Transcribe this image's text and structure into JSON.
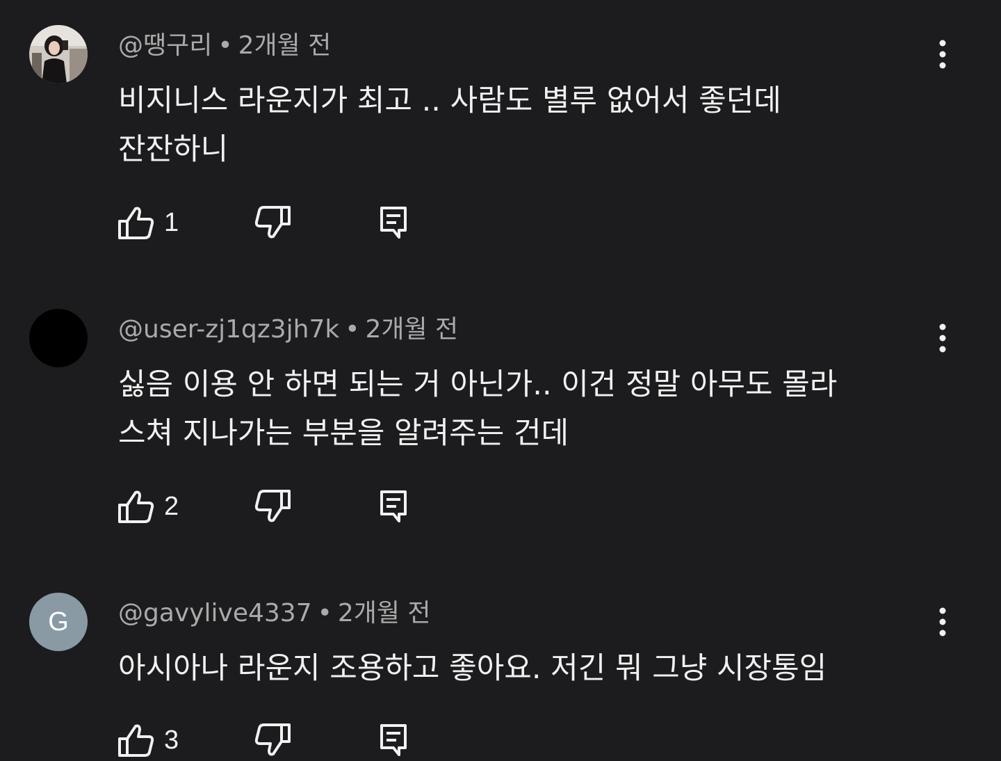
{
  "comments": [
    {
      "handle": "@땡구리",
      "separator": "•",
      "age": "2개월 전",
      "text": "비지니스 라운지가 최고 .. 사람도 별루 없어서 좋던데\n잔잔하니",
      "likes": "1",
      "avatar": {
        "type": "photo"
      }
    },
    {
      "handle": "@user-zj1qz3jh7k",
      "separator": "•",
      "age": "2개월 전",
      "text": "싫음 이용 안 하면 되는 거 아닌가.. 이건 정말 아무도 몰라\n스쳐 지나가는 부분을 알려주는 건데",
      "likes": "2",
      "avatar": {
        "type": "solid",
        "color": "#000000"
      }
    },
    {
      "handle": "@gavylive4337",
      "separator": "•",
      "age": "2개월 전",
      "text": "아시아나 라운지 조용하고 좋아요. 저긴 뭐 그냥 시장통임",
      "likes": "3",
      "avatar": {
        "type": "letter",
        "letter": "G",
        "color": "#8a9aa5"
      }
    }
  ],
  "icons": {
    "like": "thumbs-up-icon",
    "dislike": "thumbs-down-icon",
    "reply": "comment-reply-icon",
    "more": "more-vertical-icon"
  },
  "colors": {
    "background": "#1c1c1e",
    "primary_text": "#f1f1f1",
    "secondary_text": "#aaaaaa"
  }
}
